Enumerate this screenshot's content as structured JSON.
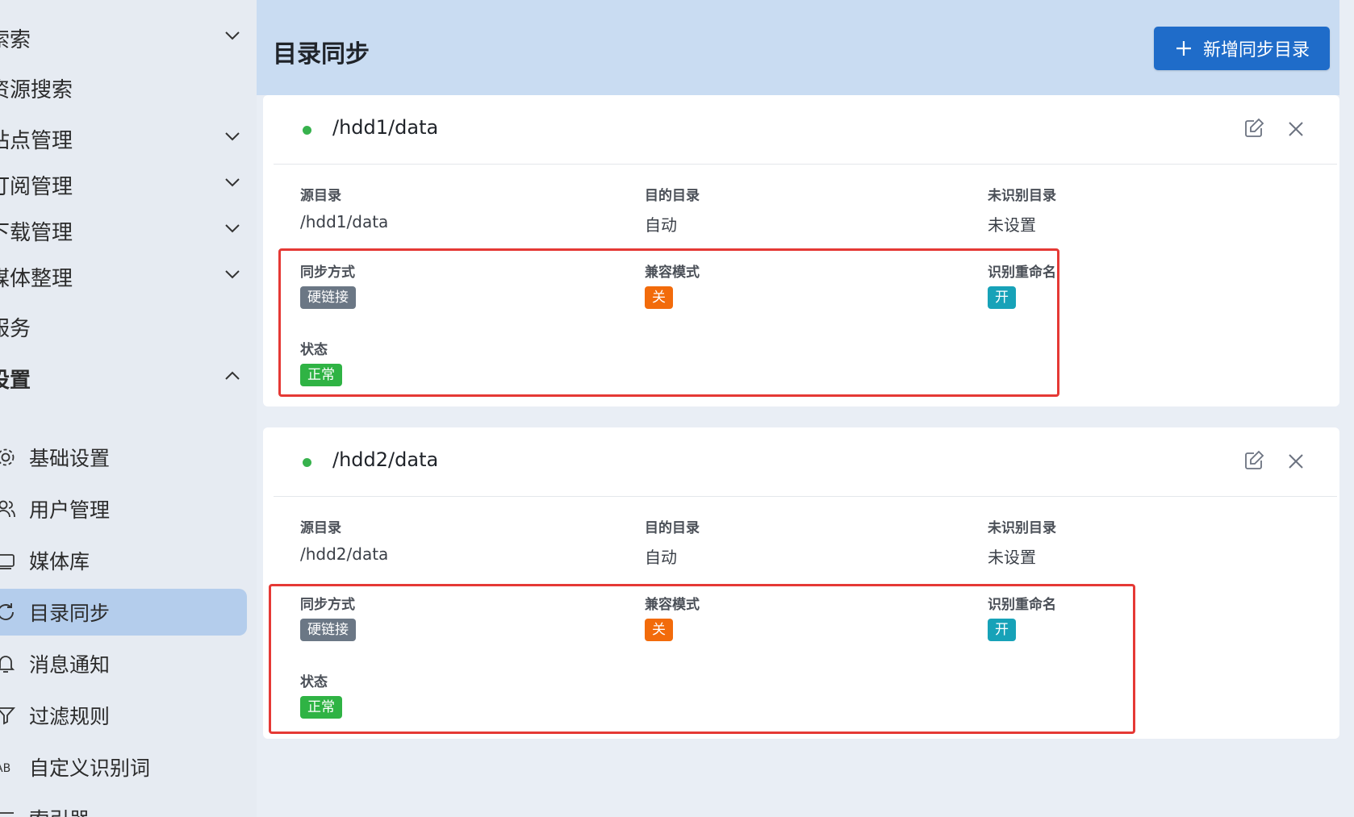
{
  "sidebar": {
    "items": [
      {
        "label": "索索",
        "expanded": false
      },
      {
        "label": "资源搜索"
      },
      {
        "label": "站点管理",
        "expanded": false
      },
      {
        "label": "订阅管理",
        "expanded": false
      },
      {
        "label": "下载管理",
        "expanded": false
      },
      {
        "label": "媒体整理",
        "expanded": false
      },
      {
        "label": "服务"
      },
      {
        "label": "设置",
        "expanded": true
      }
    ],
    "sub_items": [
      {
        "label": "基础设置",
        "icon": "gear-icon"
      },
      {
        "label": "用户管理",
        "icon": "users-icon"
      },
      {
        "label": "媒体库",
        "icon": "media-library-icon"
      },
      {
        "label": "目录同步",
        "icon": "sync-icon",
        "active": true
      },
      {
        "label": "消息通知",
        "icon": "bell-icon"
      },
      {
        "label": "过滤规则",
        "icon": "filter-icon"
      },
      {
        "label": "自定义识别词",
        "icon": "word-icon"
      },
      {
        "label": "索引器",
        "icon": "indexer-icon"
      }
    ]
  },
  "header": {
    "title": "目录同步",
    "add_button_label": "新增同步目录"
  },
  "labels": {
    "source": "源目录",
    "dest": "目的目录",
    "unknown": "未识别目录",
    "sync_mode": "同步方式",
    "compat": "兼容模式",
    "rename": "识别重命名",
    "status": "状态"
  },
  "cards": [
    {
      "title": "/hdd1/data",
      "source": "/hdd1/data",
      "dest": "自动",
      "unknown": "未设置",
      "sync_mode": "硬链接",
      "compat": "关",
      "rename": "开",
      "status": "正常"
    },
    {
      "title": "/hdd2/data",
      "source": "/hdd2/data",
      "dest": "自动",
      "unknown": "未设置",
      "sync_mode": "硬链接",
      "compat": "关",
      "rename": "开",
      "status": "正常"
    }
  ],
  "colors": {
    "accent": "#1f6cc9",
    "tag_gray": "#6b7785",
    "tag_orange": "#f26b0b",
    "tag_teal": "#17a2b8",
    "tag_green": "#2fb344",
    "status_dot": "#37b24d",
    "highlight": "#e53935"
  }
}
